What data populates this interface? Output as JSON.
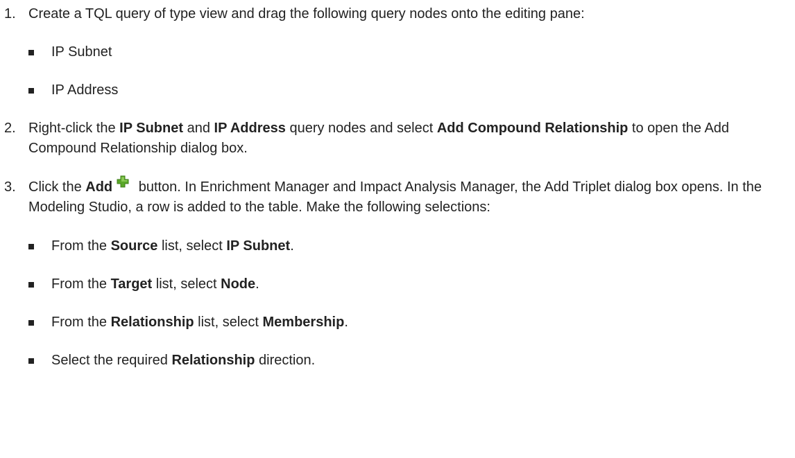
{
  "steps": [
    {
      "number": "1.",
      "text": "Create a TQL query of type view and drag the following query nodes onto the editing pane:",
      "bullets": [
        "IP Subnet",
        "IP Address"
      ]
    },
    {
      "number": "2.",
      "parts": {
        "t1": "Right-click the ",
        "b1": "IP Subnet",
        "t2": " and ",
        "b2": "IP Address",
        "t3": " query nodes and select ",
        "b3": "Add Compound Relationship",
        "t4": " to open the Add Compound Relationship dialog box."
      }
    },
    {
      "number": "3.",
      "parts": {
        "t1": "Click the ",
        "b1": "Add",
        "t2": " button. In Enrichment Manager and Impact Analysis Manager, the Add Triplet dialog box opens. In the Modeling Studio, a row is added to the table. Make the following selections:"
      },
      "icon": "add-plus-icon",
      "bullets": [
        {
          "t1": "From the ",
          "b1": "Source",
          "t2": " list, select ",
          "b2": "IP Subnet",
          "t3": "."
        },
        {
          "t1": "From the ",
          "b1": "Target",
          "t2": " list, select ",
          "b2": "Node",
          "t3": "."
        },
        {
          "t1": "From the ",
          "b1": "Relationship",
          "t2": " list, select ",
          "b2": "Membership",
          "t3": "."
        },
        {
          "t1": "Select the required ",
          "b1": "Relationship",
          "t2": " direction.",
          "b2": "",
          "t3": ""
        }
      ]
    }
  ],
  "colors": {
    "text": "#222222",
    "plus_green": "#5aa829",
    "plus_highlight": "#9fd86a"
  }
}
